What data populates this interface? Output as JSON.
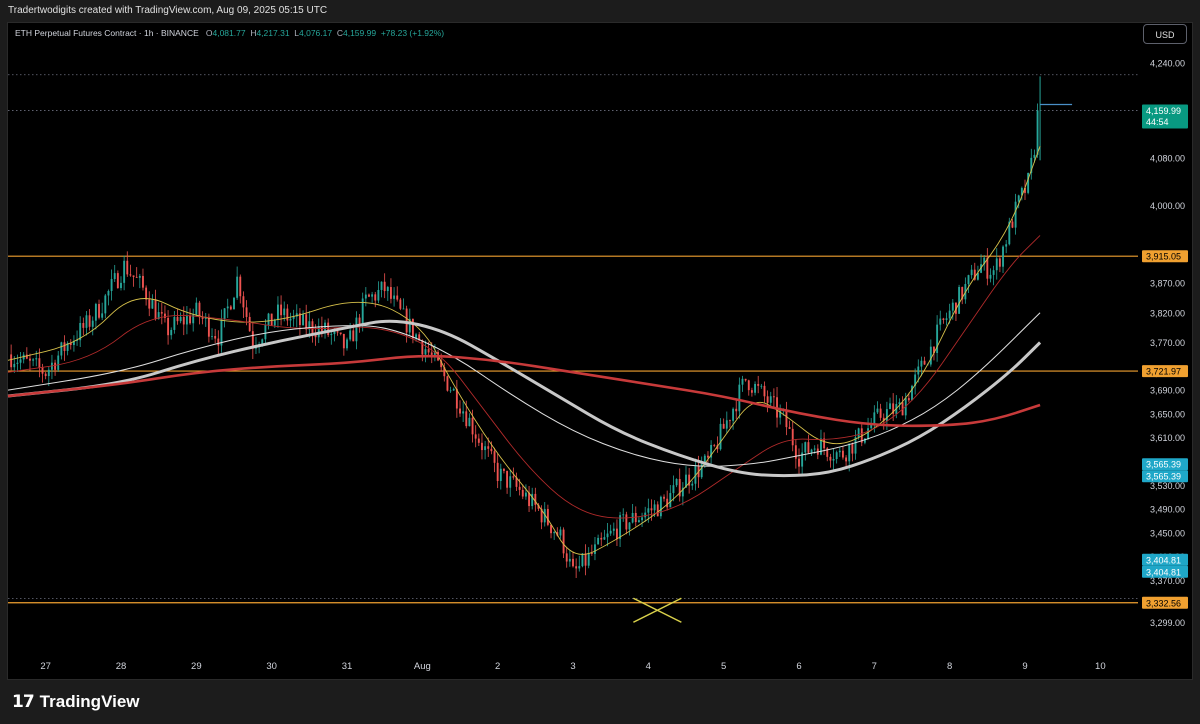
{
  "header": {
    "attribution": "Tradertwodigits created with TradingView.com, Aug 09, 2025 05:15 UTC"
  },
  "legend": {
    "symbol": "ETH Perpetual Futures Contract · 1h · BINANCE",
    "open_label": "O",
    "open": "4,081.77",
    "high_label": "H",
    "high": "4,217.31",
    "low_label": "L",
    "low": "4,076.17",
    "close_label": "C",
    "close": "4,159.99",
    "change": "+78.23 (+1.92%)"
  },
  "currency_button": "USD",
  "footer": {
    "brand": "TradingView",
    "brand_mark": "17"
  },
  "colors": {
    "background": "#000000",
    "up": "#26a69a",
    "down": "#ef5350",
    "level_line": "#f0a030",
    "ma_fast": "#d6c04a",
    "ma_slow": "#c73a3a",
    "ma_mid": "#b02a2a",
    "ma_white_thin": "#e0e0e0",
    "ma_white_thick": "#c8c8c8",
    "price_tag": "#089981",
    "marker": "#d8d04a"
  },
  "chart_data": {
    "type": "candlestick",
    "title": "ETH Perpetual Futures Contract · 1h · BINANCE",
    "currency": "USD",
    "ylim": [
      3270,
      4270
    ],
    "y_ticks": [
      4240,
      4080,
      4000,
      3870,
      3820,
      3770,
      3720,
      3690,
      3650,
      3610,
      3565.39,
      3530,
      3490,
      3450,
      3410,
      3370,
      3299
    ],
    "y_tick_labels": [
      "4,240.00",
      "4,080.00",
      "4,000.00",
      "3,870.00",
      "3,820.00",
      "3,770.00",
      "3,720.00",
      "3,690.00",
      "3,650.00",
      "3,610.00",
      "3,570.00",
      "3,530.00",
      "3,490.00",
      "3,450.00",
      "3,410.00",
      "3,370.00",
      "3,299.00"
    ],
    "x_labels": [
      "27",
      "28",
      "29",
      "30",
      "31",
      "Aug",
      "2",
      "3",
      "4",
      "5",
      "6",
      "7",
      "8",
      "9",
      "10"
    ],
    "x_label_days": [
      0,
      1,
      2,
      3,
      4,
      5,
      6,
      7,
      8,
      9,
      10,
      11,
      12,
      13,
      14
    ],
    "x_range_days": [
      -0.5,
      14.5
    ],
    "horizontal_levels": [
      3915.05,
      3721.97,
      3332.56
    ],
    "price_tags": [
      {
        "value": 4159.99,
        "label": "4,159.99",
        "sub": "44:54",
        "style": "current"
      },
      {
        "value": 3915.05,
        "label": "3,915.05",
        "style": "level"
      },
      {
        "value": 3721.97,
        "label": "3,721.97",
        "style": "level"
      },
      {
        "value": 3565.39,
        "label": "3,565.39",
        "style": "cyan"
      },
      {
        "value": 3565.39,
        "label": "3,565.39",
        "style": "cyan"
      },
      {
        "value": 3404.81,
        "label": "3,404.81",
        "style": "cyan"
      },
      {
        "value": 3404.81,
        "label": "3,404.81",
        "style": "cyan"
      },
      {
        "value": 3332.56,
        "label": "3,332.56",
        "style": "level"
      }
    ],
    "dotted_lines": [
      4220,
      4160,
      3340
    ],
    "marker_day": 8.12,
    "marker_value": 3320,
    "price_anchors": {
      "days": [
        -0.5,
        0.0,
        0.3,
        0.55,
        0.75,
        1.05,
        1.35,
        1.6,
        2.0,
        2.3,
        2.55,
        2.75,
        3.1,
        3.4,
        3.7,
        4.0,
        4.25,
        4.5,
        4.75,
        5.1,
        5.45,
        5.7,
        6.0,
        6.3,
        6.6,
        6.85,
        7.0,
        7.3,
        7.6,
        7.9,
        8.2,
        8.5,
        8.8,
        9.05,
        9.3,
        9.6,
        9.8,
        10.0,
        10.25,
        10.55,
        10.8,
        11.1,
        11.35,
        11.6,
        11.9,
        12.1,
        12.4,
        12.6,
        12.9,
        13.05,
        13.2
      ],
      "values": [
        3750,
        3720,
        3770,
        3800,
        3835,
        3900,
        3850,
        3790,
        3820,
        3780,
        3880,
        3770,
        3820,
        3800,
        3790,
        3760,
        3840,
        3860,
        3810,
        3750,
        3680,
        3620,
        3550,
        3520,
        3480,
        3440,
        3380,
        3420,
        3460,
        3480,
        3500,
        3540,
        3570,
        3640,
        3710,
        3670,
        3640,
        3580,
        3600,
        3580,
        3610,
        3650,
        3660,
        3720,
        3800,
        3840,
        3900,
        3890,
        4000,
        4040,
        4159.99
      ]
    },
    "series": [
      {
        "name": "",
        "role": "ma_fast",
        "days": [
          -0.5,
          0.5,
          1.2,
          2.0,
          3.0,
          4.2,
          5.0,
          5.4,
          6.0,
          6.6,
          7.0,
          7.6,
          8.2,
          8.6,
          9.0,
          9.4,
          9.8,
          10.4,
          11.0,
          11.6,
          12.2,
          12.8,
          13.2
        ],
        "values": [
          3740,
          3770,
          3860,
          3810,
          3800,
          3850,
          3800,
          3700,
          3580,
          3490,
          3400,
          3440,
          3490,
          3540,
          3610,
          3680,
          3650,
          3590,
          3620,
          3700,
          3860,
          3960,
          4100
        ]
      },
      {
        "name": "",
        "role": "ma_mid",
        "days": [
          -0.5,
          0.6,
          1.4,
          2.4,
          3.4,
          4.4,
          5.2,
          5.8,
          6.4,
          7.0,
          7.6,
          8.4,
          9.2,
          9.8,
          10.4,
          11.0,
          11.6,
          12.2,
          12.8,
          13.2
        ],
        "values": [
          3720,
          3740,
          3820,
          3810,
          3790,
          3800,
          3760,
          3660,
          3560,
          3490,
          3470,
          3490,
          3560,
          3610,
          3605,
          3620,
          3680,
          3790,
          3900,
          3950
        ]
      },
      {
        "name": "",
        "role": "ma_white_thin",
        "days": [
          -0.5,
          1.0,
          2.0,
          3.0,
          4.0,
          4.6,
          5.4,
          6.2,
          7.0,
          7.8,
          8.6,
          9.4,
          10.0,
          10.6,
          11.2,
          11.8,
          12.4,
          13.2
        ],
        "values": [
          3690,
          3720,
          3760,
          3790,
          3800,
          3795,
          3750,
          3680,
          3620,
          3580,
          3560,
          3565,
          3580,
          3595,
          3620,
          3660,
          3720,
          3820
        ]
      },
      {
        "name": "",
        "role": "ma_white_thick",
        "days": [
          -0.5,
          1.0,
          2.0,
          3.0,
          4.0,
          4.6,
          5.3,
          6.0,
          6.8,
          7.6,
          8.4,
          9.2,
          9.8,
          10.4,
          11.0,
          11.6,
          12.2,
          12.8,
          13.2
        ],
        "values": [
          3680,
          3700,
          3740,
          3770,
          3795,
          3810,
          3790,
          3740,
          3680,
          3620,
          3580,
          3550,
          3545,
          3550,
          3575,
          3610,
          3660,
          3720,
          3770
        ]
      },
      {
        "name": "",
        "role": "ma_slow",
        "days": [
          -0.5,
          1.0,
          2.0,
          3.0,
          4.0,
          5.0,
          6.0,
          7.0,
          8.0,
          9.0,
          10.0,
          11.0,
          12.0,
          12.6,
          13.2
        ],
        "values": [
          3680,
          3700,
          3720,
          3730,
          3735,
          3750,
          3740,
          3720,
          3700,
          3680,
          3650,
          3630,
          3630,
          3640,
          3665
        ]
      }
    ]
  }
}
